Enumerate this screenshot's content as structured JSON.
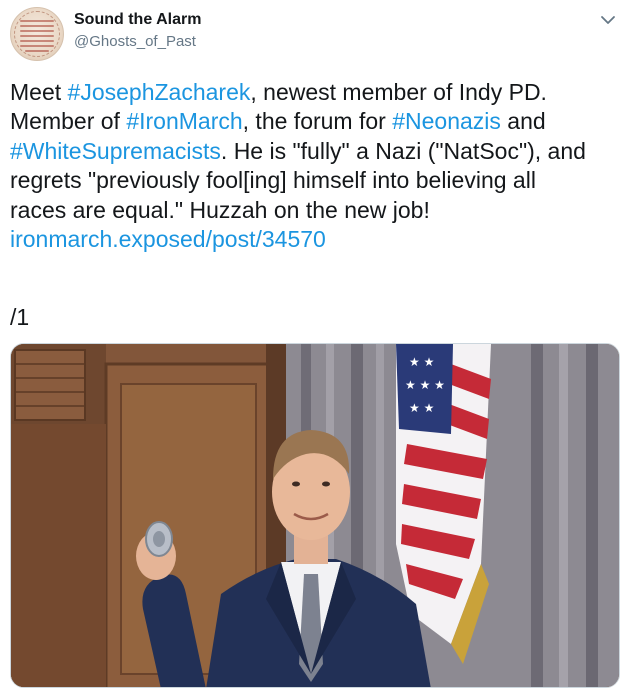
{
  "author": {
    "display_name": "Sound the Alarm",
    "handle": "@Ghosts_of_Past",
    "avatar_icon": "vintage-seal-avatar"
  },
  "menu": {
    "icon": "chevron-down-icon"
  },
  "tweet": {
    "line1": {
      "before": "Meet ",
      "hashtag": "#JosephZacharek",
      "after": ", newest member of Indy PD."
    },
    "line2": {
      "before": "Member of ",
      "hashtag1": "#IronMarch",
      "middle": ", the forum for ",
      "hashtag2": "#Neonazis",
      "after": " and"
    },
    "line3": {
      "hashtag": "#WhiteSupremacists",
      "after": ". He is \"fully\" a Nazi (\"NatSoc\"), and"
    },
    "line4": "regrets \"previously fool[ing] himself into believing all",
    "line5": "races are equal.\" Huzzah on the new job!",
    "link": "ironmarch.exposed/post/34570",
    "thread_count": "/1"
  },
  "colors": {
    "link": "#1b95e0",
    "text": "#14171a",
    "secondary": "#657786"
  }
}
